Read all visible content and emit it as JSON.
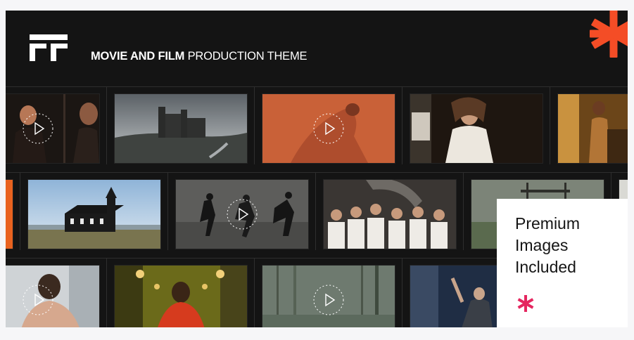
{
  "header": {
    "title_bold": "MOVIE AND FILM",
    "title_light": "PRODUCTION THEME",
    "logo_icon": "ff-logo-icon",
    "accent_icon": "orange-asterisk-icon"
  },
  "promo": {
    "text": "Premium Images Included",
    "star_icon": "pink-asterisk-icon"
  },
  "colors": {
    "background": "#141414",
    "page": "#f6f6f8",
    "accent_orange": "#f44d26",
    "accent_pink": "#e5265f",
    "text_light": "#ffffff",
    "card": "#ffffff"
  },
  "gallery": {
    "rows": [
      [
        "woman-with-play-badge",
        "castle-on-hill",
        "orange-dancer-with-play-badge",
        "woman-in-white-dress",
        "man-in-warm-room"
      ],
      [
        "orange-edge",
        "black-church-in-field",
        "running-men-with-play-badge",
        "choir-boys",
        "sign-in-field",
        "partial-frame"
      ],
      [
        "woman-with-play-badge",
        "woman-in-red-corridor",
        "foggy-forest-with-play-badge",
        "man-raising-hand"
      ]
    ]
  }
}
